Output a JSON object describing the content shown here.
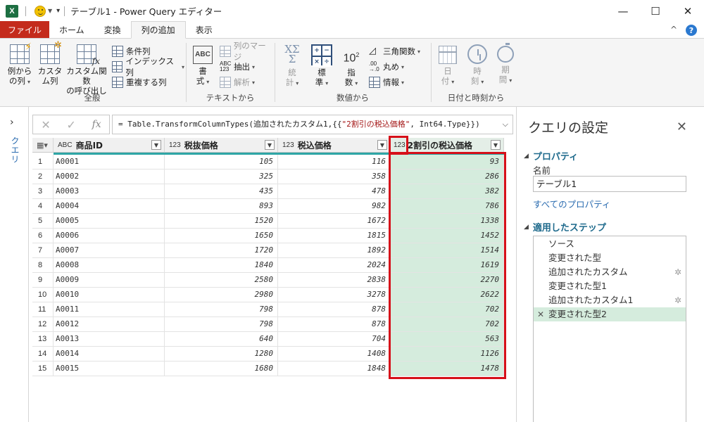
{
  "titlebar": {
    "app_icon": "X",
    "title": "テーブル1 - Power Query エディター",
    "minimize": "—",
    "maximize": "☐",
    "close": "✕"
  },
  "tabs": [
    {
      "label": "ファイル"
    },
    {
      "label": "ホーム"
    },
    {
      "label": "変換"
    },
    {
      "label": "列の追加"
    },
    {
      "label": "表示"
    }
  ],
  "ribbon": {
    "groups": {
      "general": "全般",
      "text": "テキストから",
      "number": "数値から",
      "datetime": "日付と時刻から"
    },
    "buttons": {
      "column_from_examples": [
        "例から",
        "の列"
      ],
      "custom_column": [
        "カスタ",
        "ム列"
      ],
      "invoke_custom_function": [
        "カスタム関数",
        "の呼び出し"
      ],
      "conditional_column": "条件列",
      "index_column": "インデックス列",
      "duplicate_column": "重複する列",
      "format": [
        "書",
        "式"
      ],
      "merge_columns": "列のマージ",
      "extract": "抽出",
      "parse": "解析",
      "statistics": [
        "統",
        "計"
      ],
      "standard": [
        "標",
        "準"
      ],
      "scientific": [
        "指",
        "数"
      ],
      "trigonometry": "三角関数",
      "rounding": "丸め",
      "information": "情報",
      "date": [
        "日",
        "付"
      ],
      "time": [
        "時",
        "刻"
      ],
      "duration": [
        "期",
        "間"
      ]
    }
  },
  "queries_pane": {
    "label": "クエリ"
  },
  "formula": {
    "prefix": "= Table.TransformColumnTypes(追加されたカスタム1,{{",
    "str": "\"2割引の税込価格\"",
    "suffix": ", Int64.Type}})"
  },
  "grid": {
    "columns": [
      {
        "type": "ABC",
        "name": "商品ID"
      },
      {
        "type": "123",
        "name": "税抜価格"
      },
      {
        "type": "123",
        "name": "税込価格"
      },
      {
        "type": "123",
        "name": "2割引の税込価格"
      }
    ],
    "rows": [
      {
        "n": "1",
        "id": "A0001",
        "pre": "105",
        "tax": "116",
        "disc": "93"
      },
      {
        "n": "2",
        "id": "A0002",
        "pre": "325",
        "tax": "358",
        "disc": "286"
      },
      {
        "n": "3",
        "id": "A0003",
        "pre": "435",
        "tax": "478",
        "disc": "382"
      },
      {
        "n": "4",
        "id": "A0004",
        "pre": "893",
        "tax": "982",
        "disc": "786"
      },
      {
        "n": "5",
        "id": "A0005",
        "pre": "1520",
        "tax": "1672",
        "disc": "1338"
      },
      {
        "n": "6",
        "id": "A0006",
        "pre": "1650",
        "tax": "1815",
        "disc": "1452"
      },
      {
        "n": "7",
        "id": "A0007",
        "pre": "1720",
        "tax": "1892",
        "disc": "1514"
      },
      {
        "n": "8",
        "id": "A0008",
        "pre": "1840",
        "tax": "2024",
        "disc": "1619"
      },
      {
        "n": "9",
        "id": "A0009",
        "pre": "2580",
        "tax": "2838",
        "disc": "2270"
      },
      {
        "n": "10",
        "id": "A0010",
        "pre": "2980",
        "tax": "3278",
        "disc": "2622"
      },
      {
        "n": "11",
        "id": "A0011",
        "pre": "798",
        "tax": "878",
        "disc": "702"
      },
      {
        "n": "12",
        "id": "A0012",
        "pre": "798",
        "tax": "878",
        "disc": "702"
      },
      {
        "n": "13",
        "id": "A0013",
        "pre": "640",
        "tax": "704",
        "disc": "563"
      },
      {
        "n": "14",
        "id": "A0014",
        "pre": "1280",
        "tax": "1408",
        "disc": "1126"
      },
      {
        "n": "15",
        "id": "A0015",
        "pre": "1680",
        "tax": "1848",
        "disc": "1478"
      }
    ]
  },
  "settings": {
    "title": "クエリの設定",
    "properties_header": "プロパティ",
    "name_label": "名前",
    "name_value": "テーブル1",
    "all_properties": "すべてのプロパティ",
    "steps_header": "適用したステップ",
    "steps": [
      {
        "label": "ソース",
        "gear": false,
        "active": false
      },
      {
        "label": "変更された型",
        "gear": false,
        "active": false
      },
      {
        "label": "追加されたカスタム",
        "gear": true,
        "active": false
      },
      {
        "label": "変更された型1",
        "gear": false,
        "active": false
      },
      {
        "label": "追加されたカスタム1",
        "gear": true,
        "active": false
      },
      {
        "label": "変更された型2",
        "gear": false,
        "active": true
      }
    ]
  },
  "colors": {
    "file_tab": "#c42b1c",
    "highlight_red": "#d6101a",
    "selected_fill": "#d5ecdd",
    "quality_bar": "#2ea6a6",
    "link": "#2b6cb0"
  }
}
